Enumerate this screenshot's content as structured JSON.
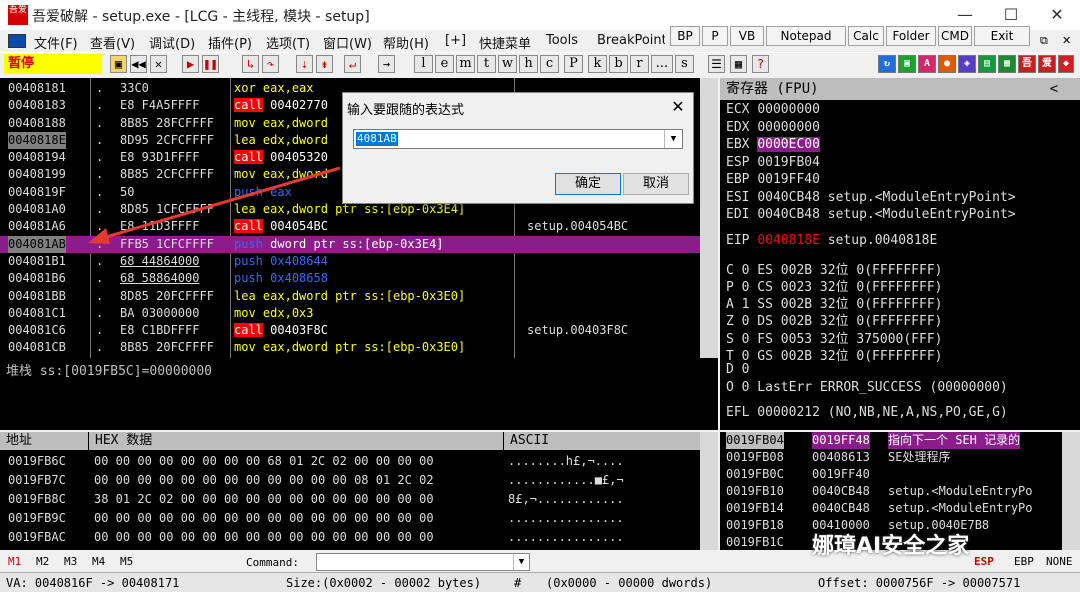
{
  "window": {
    "logo_text": "吾爱",
    "title": "吾爱破解 - setup.exe - [LCG - 主线程, 模块 - setup]",
    "minimize": "—",
    "maximize": "☐",
    "close": "✕"
  },
  "menu": [
    "文件(F)",
    "查看(V)",
    "调试(D)",
    "插件(P)",
    "选项(T)",
    "窗口(W)",
    "帮助(H)",
    "[+]",
    "快捷菜单",
    "Tools",
    "BreakPoint"
  ],
  "plugin_buttons": [
    "BP",
    "P",
    "VB",
    "Notepad",
    "Calc",
    "Folder",
    "CMD",
    "Exit"
  ],
  "toolbar": {
    "status": "暂停",
    "letters": [
      "l",
      "e",
      "m",
      "t",
      "w",
      "h",
      "c",
      "P",
      "k",
      "b",
      "r",
      "...",
      "s"
    ],
    "restore_icon": "⧉",
    "mdi_close": "✕"
  },
  "cpu": {
    "rows": [
      {
        "addr": "00408181",
        "dot": ".",
        "hex": "33C0",
        "mn": "xor",
        "op": "eax,eax",
        "cmt": ""
      },
      {
        "addr": "00408183",
        "dot": ".",
        "hex": "E8 F4A5FFFF",
        "mn": "call",
        "op": "00402770",
        "cmt": ""
      },
      {
        "addr": "00408188",
        "dot": ".",
        "hex": "8B85 28FCFFFF",
        "mn": "mov",
        "op": "eax,dword",
        "cmt": ""
      },
      {
        "addr": "0040818E",
        "dot": ".",
        "hex": "8D95 2CFCFFFF",
        "mn": "lea",
        "op": "edx,dword",
        "cmt": ""
      },
      {
        "addr": "00408194",
        "dot": ".",
        "hex": "E8 93D1FFFF",
        "mn": "call",
        "op": "00405320",
        "cmt": ""
      },
      {
        "addr": "00408199",
        "dot": ".",
        "hex": "8B85 2CFCFFFF",
        "mn": "mov",
        "op": "eax,dword",
        "cmt": ""
      },
      {
        "addr": "0040819F",
        "dot": ".",
        "hex": "50",
        "mn": "push",
        "op": "eax",
        "cmt": ""
      },
      {
        "addr": "004081A0",
        "dot": ".",
        "hex": "8D85 1CFCFFFF",
        "mn": "lea",
        "op": "eax,dword ptr ss:[ebp-0x3E4]",
        "cmt": ""
      },
      {
        "addr": "004081A6",
        "dot": ".",
        "hex": "E8 11D3FFFF",
        "mn": "call",
        "op": "004054BC",
        "cmt": "setup.004054BC"
      },
      {
        "addr": "004081AB",
        "dot": ".",
        "hex": "FFB5 1CFCFFFF",
        "mn": "push",
        "op": "dword ptr ss:[ebp-0x3E4]",
        "cmt": ""
      },
      {
        "addr": "004081B1",
        "dot": ".",
        "hex": "68 44864000",
        "mn": "push",
        "op": "0x408644",
        "cmt": ""
      },
      {
        "addr": "004081B6",
        "dot": ".",
        "hex": "68 58864000",
        "mn": "push",
        "op": "0x408658",
        "cmt": ""
      },
      {
        "addr": "004081BB",
        "dot": ".",
        "hex": "8D85 20FCFFFF",
        "mn": "lea",
        "op": "eax,dword ptr ss:[ebp-0x3E0]",
        "cmt": ""
      },
      {
        "addr": "004081C1",
        "dot": ".",
        "hex": "BA 03000000",
        "mn": "mov",
        "op": "edx,0x3",
        "cmt": ""
      },
      {
        "addr": "004081C6",
        "dot": ".",
        "hex": "E8 C1BDFFFF",
        "mn": "call",
        "op": "00403F8C",
        "cmt": "setup.00403F8C"
      },
      {
        "addr": "004081CB",
        "dot": ".",
        "hex": "8B85 20FCFFFF",
        "mn": "mov",
        "op": "eax,dword ptr ss:[ebp-0x3E0]",
        "cmt": ""
      }
    ]
  },
  "stack_info": "堆栈 ss:[0019FB5C]=00000000",
  "registers": {
    "title": "寄存器 (FPU)",
    "collapse": "<",
    "gp": [
      {
        "name": "ECX",
        "val": "00000000",
        "note": ""
      },
      {
        "name": "EDX",
        "val": "00000000",
        "note": ""
      },
      {
        "name": "EBX",
        "val": "0000EC00",
        "note": ""
      },
      {
        "name": "ESP",
        "val": "0019FB04",
        "note": ""
      },
      {
        "name": "EBP",
        "val": "0019FF40",
        "note": ""
      },
      {
        "name": "ESI",
        "val": "0040CB48",
        "note": "setup.<ModuleEntryPoint>"
      },
      {
        "name": "EDI",
        "val": "0040CB48",
        "note": "setup.<ModuleEntryPoint>"
      }
    ],
    "eip": {
      "name": "EIP",
      "val": "0040818E",
      "note": "setup.0040818E"
    },
    "flags": [
      "C 0  ES 002B 32位 0(FFFFFFFF)",
      "P 0  CS 0023 32位 0(FFFFFFFF)",
      "A 1  SS 002B 32位 0(FFFFFFFF)",
      "Z 0  DS 002B 32位 0(FFFFFFFF)",
      "S 0  FS 0053 32位 375000(FFF)",
      "T 0  GS 002B 32位 0(FFFFFFFF)",
      "D 0",
      "O 0  LastErr ERROR_SUCCESS (00000000)"
    ],
    "efl": "EFL 00000212 (NO,NB,NE,A,NS,PO,GE,G)"
  },
  "dump": {
    "col_addr": "地址",
    "col_hex": "HEX 数据",
    "col_ascii": "ASCII",
    "rows": [
      {
        "addr": "0019FB6C",
        "hex": "00 00 00 00 00 00 00 00 68 01 2C 02 00 00 00 00",
        "ascii": "........h£,¬...."
      },
      {
        "addr": "0019FB7C",
        "hex": "00 00 00 00 00 00 00 00 00 00 00 00 08 01 2C 02",
        "ascii": "............■£,¬"
      },
      {
        "addr": "0019FB8C",
        "hex": "38 01 2C 02 00 00 00 00 00 00 00 00 00 00 00 00",
        "ascii": "8£,¬............"
      },
      {
        "addr": "0019FB9C",
        "hex": "00 00 00 00 00 00 00 00 00 00 00 00 00 00 00 00",
        "ascii": "................"
      },
      {
        "addr": "0019FBAC",
        "hex": "00 00 00 00 00 00 00 00 00 00 00 00 00 00 00 00",
        "ascii": "................"
      }
    ]
  },
  "stack": {
    "rows": [
      {
        "addr": "0019FB04",
        "val": "0019FF48",
        "cmt": "指向下一个 SEH 记录的"
      },
      {
        "addr": "0019FB08",
        "val": "00408613",
        "cmt": "SE处理程序"
      },
      {
        "addr": "0019FB0C",
        "val": "0019FF40",
        "cmt": ""
      },
      {
        "addr": "0019FB10",
        "val": "0040CB48",
        "cmt": "setup.<ModuleEntryPo"
      },
      {
        "addr": "0019FB14",
        "val": "0040CB48",
        "cmt": "setup.<ModuleEntryPo"
      },
      {
        "addr": "0019FB18",
        "val": "00410000",
        "cmt": "setup.0040E7B8"
      },
      {
        "addr": "0019FB1C",
        "val": "",
        "cmt": ""
      }
    ]
  },
  "cmdbar": {
    "markers": [
      "M1",
      "M2",
      "M3",
      "M4",
      "M5"
    ],
    "command_label": "Command:",
    "command_value": "",
    "right_labels": [
      "ESP",
      "EBP",
      "NONE"
    ]
  },
  "statusbar": {
    "va": "VA: 0040816F -> 00408171",
    "size": "Size:(0x0002 - 00002 bytes)",
    "hash": "#",
    "dwords": "(0x0000 - 00000 dwords)",
    "offset": "Offset: 0000756F -> 00007571"
  },
  "dialog": {
    "title": "输入要跟随的表达式",
    "value": "4081AB",
    "ok": "确定",
    "cancel": "取消",
    "close": "✕"
  },
  "watermark": "娜璋AI安全之家",
  "colors": {
    "call_bg": "#ff0000",
    "push_fg": "#2f6bff",
    "highlight_row": "#8b1d8b",
    "status_pause_bg": "#ffff00",
    "eip_val": "#ff0000",
    "arrow": "#e53935"
  }
}
